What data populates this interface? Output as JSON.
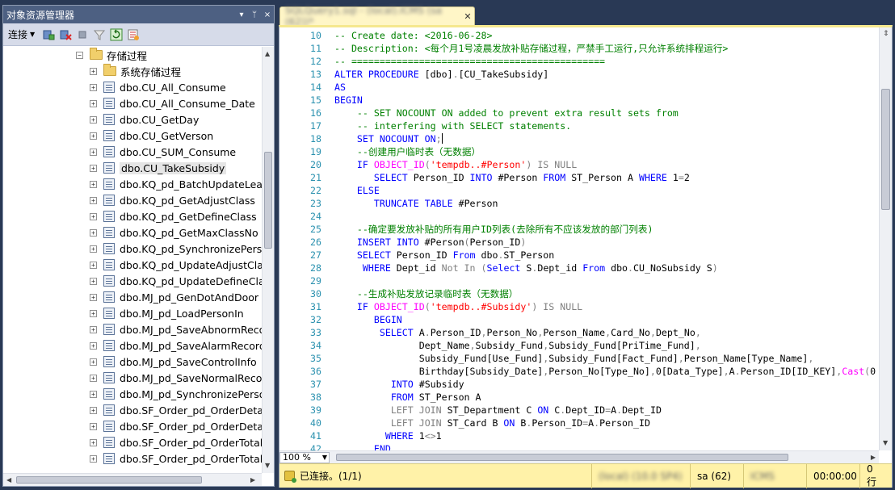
{
  "object_explorer": {
    "title": "对象资源管理器",
    "title_controls": [
      "▾",
      "ᛘ",
      "×"
    ],
    "toolbar": {
      "connect_label": "连接"
    },
    "tree": {
      "folder_label": "存储过程",
      "system_folder_label": "系统存储过程",
      "items": [
        "dbo.CU_All_Consume",
        "dbo.CU_All_Consume_Date",
        "dbo.CU_GetDay",
        "dbo.CU_GetVerson",
        "dbo.CU_SUM_Consume",
        "dbo.CU_TakeSubsidy",
        "dbo.KQ_pd_BatchUpdateLeave",
        "dbo.KQ_pd_GetAdjustClass",
        "dbo.KQ_pd_GetDefineClass",
        "dbo.KQ_pd_GetMaxClassNo",
        "dbo.KQ_pd_SynchronizePerso",
        "dbo.KQ_pd_UpdateAdjustClas",
        "dbo.KQ_pd_UpdateDefineClas",
        "dbo.MJ_pd_GenDotAndDoor",
        "dbo.MJ_pd_LoadPersonIn",
        "dbo.MJ_pd_SaveAbnormReco",
        "dbo.MJ_pd_SaveAlarmRecord",
        "dbo.MJ_pd_SaveControlInfo",
        "dbo.MJ_pd_SaveNormalRecor",
        "dbo.MJ_pd_SynchronizePersor",
        "dbo.SF_Order_pd_OrderDetail",
        "dbo.SF_Order_pd_OrderDetail",
        "dbo.SF_Order_pd_OrderTotalC",
        "dbo.SF_Order_pd_OrderTotalC"
      ],
      "selected_item": "dbo.CU_TakeSubsidy"
    }
  },
  "editor": {
    "tab_title": "SQLQuery1.sql - (local).ICMS (sa (62))*",
    "zoom": "100 %",
    "lines": [
      {
        "n": "10",
        "html": "<span class='cm'>-- Create date: &lt;2016-06-28&gt;</span>"
      },
      {
        "n": "11",
        "html": "<span class='cm'>-- Description: &lt;每个月1号凌晨发放补贴存储过程，严禁手工运行,只允许系统排程运行&gt;</span>"
      },
      {
        "n": "12",
        "html": "<span class='cm'>-- =============================================</span>"
      },
      {
        "n": "13",
        "html": "<span class='kw'>ALTER PROCEDURE</span> [dbo]<span class='gy'>.</span>[CU_TakeSubsidy]"
      },
      {
        "n": "14",
        "html": "<span class='kw'>AS</span>"
      },
      {
        "n": "15",
        "html": "<span class='kw'>BEGIN</span>"
      },
      {
        "n": "16",
        "html": "    <span class='cm'>-- SET NOCOUNT ON added to prevent extra result sets from</span>"
      },
      {
        "n": "17",
        "html": "    <span class='cm'>-- interfering with SELECT statements.</span>"
      },
      {
        "n": "18",
        "html": "    <span class='kw'>SET NOCOUNT ON</span><span class='gy'>;</span><span class='caret-bar'></span>"
      },
      {
        "n": "19",
        "html": "    <span class='cm'>--创建用户临时表（无数据）</span>"
      },
      {
        "n": "20",
        "html": "    <span class='kw'>IF</span> <span class='fn'>OBJECT_ID</span><span class='gy'>(</span><span class='st'>'tempdb..#Person'</span><span class='gy'>)</span> <span class='gy'>IS NULL</span>"
      },
      {
        "n": "21",
        "html": "       <span class='kw'>SELECT</span> Person_ID <span class='kw'>INTO</span> #Person <span class='kw'>FROM</span> ST_Person A <span class='kw'>WHERE</span> 1<span class='gy'>=</span>2"
      },
      {
        "n": "22",
        "html": "    <span class='kw'>ELSE</span>"
      },
      {
        "n": "23",
        "html": "       <span class='kw'>TRUNCATE TABLE</span> #Person"
      },
      {
        "n": "24",
        "html": ""
      },
      {
        "n": "25",
        "html": "    <span class='cm'>--确定要发放补贴的所有用户ID列表(去除所有不应该发放的部门列表)</span>"
      },
      {
        "n": "26",
        "html": "    <span class='kw'>INSERT INTO</span> #Person<span class='gy'>(</span>Person_ID<span class='gy'>)</span>"
      },
      {
        "n": "27",
        "html": "    <span class='kw'>SELECT</span> Person_ID <span class='kw'>From</span> dbo<span class='gy'>.</span>ST_Person"
      },
      {
        "n": "28",
        "html": "     <span class='kw'>WHERE</span> Dept_id <span class='gy'>Not In</span> <span class='gy'>(</span><span class='kw'>Select</span> S<span class='gy'>.</span>Dept_id <span class='kw'>From</span> dbo<span class='gy'>.</span>CU_NoSubsidy S<span class='gy'>)</span>"
      },
      {
        "n": "29",
        "html": ""
      },
      {
        "n": "30",
        "html": "    <span class='cm'>--生成补贴发放记录临时表（无数据）</span>"
      },
      {
        "n": "31",
        "html": "    <span class='kw'>IF</span> <span class='fn'>OBJECT_ID</span><span class='gy'>(</span><span class='st'>'tempdb..#Subsidy'</span><span class='gy'>)</span> <span class='gy'>IS NULL</span>"
      },
      {
        "n": "32",
        "html": "       <span class='kw'>BEGIN</span>"
      },
      {
        "n": "33",
        "html": "        <span class='kw'>SELECT</span> A<span class='gy'>.</span>Person_ID<span class='gy'>,</span>Person_No<span class='gy'>,</span>Person_Name<span class='gy'>,</span>Card_No<span class='gy'>,</span>Dept_No<span class='gy'>,</span>"
      },
      {
        "n": "34",
        "html": "               Dept_Name<span class='gy'>,</span>Subsidy_Fund<span class='gy'>,</span>Subsidy_Fund[PriTime_Fund]<span class='gy'>,</span>"
      },
      {
        "n": "35",
        "html": "               Subsidy_Fund[Use_Fund]<span class='gy'>,</span>Subsidy_Fund[Fact_Fund]<span class='gy'>,</span>Person_Name[Type_Name]<span class='gy'>,</span>"
      },
      {
        "n": "36",
        "html": "               Birthday[Subsidy_Date]<span class='gy'>,</span>Person_No[Type_No]<span class='gy'>,</span>0[Data_Type]<span class='gy'>,</span>A<span class='gy'>.</span>Person_ID[ID_KEY]<span class='gy'>,</span><span class='fn'>Cast</span><span class='gy'>(</span>0"
      },
      {
        "n": "37",
        "html": "          <span class='kw'>INTO</span> #Subsidy"
      },
      {
        "n": "38",
        "html": "          <span class='kw'>FROM</span> ST_Person A"
      },
      {
        "n": "39",
        "html": "          <span class='gy'>LEFT JOIN</span> ST_Department C <span class='kw'>ON</span> C<span class='gy'>.</span>Dept_ID<span class='gy'>=</span>A<span class='gy'>.</span>Dept_ID"
      },
      {
        "n": "40",
        "html": "          <span class='gy'>LEFT JOIN</span> ST_Card B <span class='kw'>ON</span> B<span class='gy'>.</span>Person_ID<span class='gy'>=</span>A<span class='gy'>.</span>Person_ID"
      },
      {
        "n": "41",
        "html": "         <span class='kw'>WHERE</span> 1<span class='gy'>&lt;&gt;</span>1"
      },
      {
        "n": "42",
        "html": "       <span class='kw'>END</span>"
      }
    ]
  },
  "status_bar": {
    "connected": "已连接。(1/1)",
    "server": "(local) (10.0 SP4)",
    "user": "sa (62)",
    "database": "ICMS",
    "time": "00:00:00",
    "rows": "0 行"
  }
}
